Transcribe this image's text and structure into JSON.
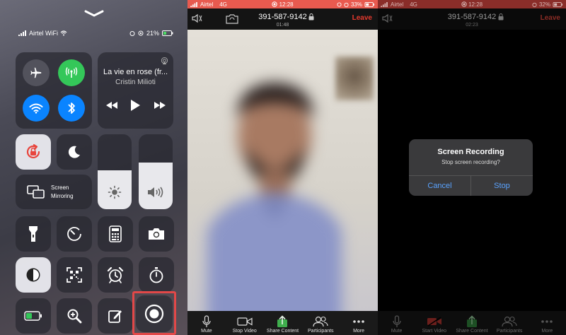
{
  "control_center": {
    "status": {
      "carrier": "Airtel WiFi",
      "battery": "21%"
    },
    "music": {
      "title": "La vie en rose (fr...",
      "artist": "Cristin Milioti"
    },
    "screen_mirroring": {
      "line1": "Screen",
      "line2": "Mirroring"
    },
    "brightness_level": 0.52,
    "volume_level": 0.62,
    "toggles": {
      "airplane": "off",
      "cellular": "on",
      "wifi": "on",
      "bluetooth": "on",
      "rotation_lock": "on",
      "do_not_disturb": "off"
    },
    "colors": {
      "green": "#34c759",
      "blue": "#0a84ff",
      "lock_red": "#e8443c",
      "highlight": "#e24848"
    }
  },
  "call_screen": {
    "status": {
      "carrier": "Airtel",
      "network": "4G",
      "time": "12:28",
      "battery": "33%"
    },
    "meeting_id": "391-587-9142",
    "timer": "01:48",
    "leave_label": "Leave",
    "toolbar": [
      {
        "label": "Mute",
        "icon": "microphone-icon"
      },
      {
        "label": "Stop Video",
        "icon": "video-camera-icon"
      },
      {
        "label": "Share Content",
        "icon": "share-icon"
      },
      {
        "label": "Participants",
        "icon": "participants-icon"
      },
      {
        "label": "More",
        "icon": "more-icon"
      }
    ]
  },
  "stop_screen": {
    "status": {
      "carrier": "Airtel",
      "network": "4G",
      "time": "12:28",
      "battery": "32%"
    },
    "meeting_id": "391-587-9142",
    "timer": "02:23",
    "leave_label": "Leave",
    "dialog": {
      "title": "Screen Recording",
      "message": "Stop screen recording?",
      "cancel_label": "Cancel",
      "stop_label": "Stop"
    },
    "toolbar": [
      {
        "label": "Mute",
        "icon": "microphone-icon"
      },
      {
        "label": "Start Video",
        "icon": "video-camera-off-icon"
      },
      {
        "label": "Share Content",
        "icon": "share-icon"
      },
      {
        "label": "Participants",
        "icon": "participants-icon"
      },
      {
        "label": "More",
        "icon": "more-icon"
      }
    ]
  }
}
